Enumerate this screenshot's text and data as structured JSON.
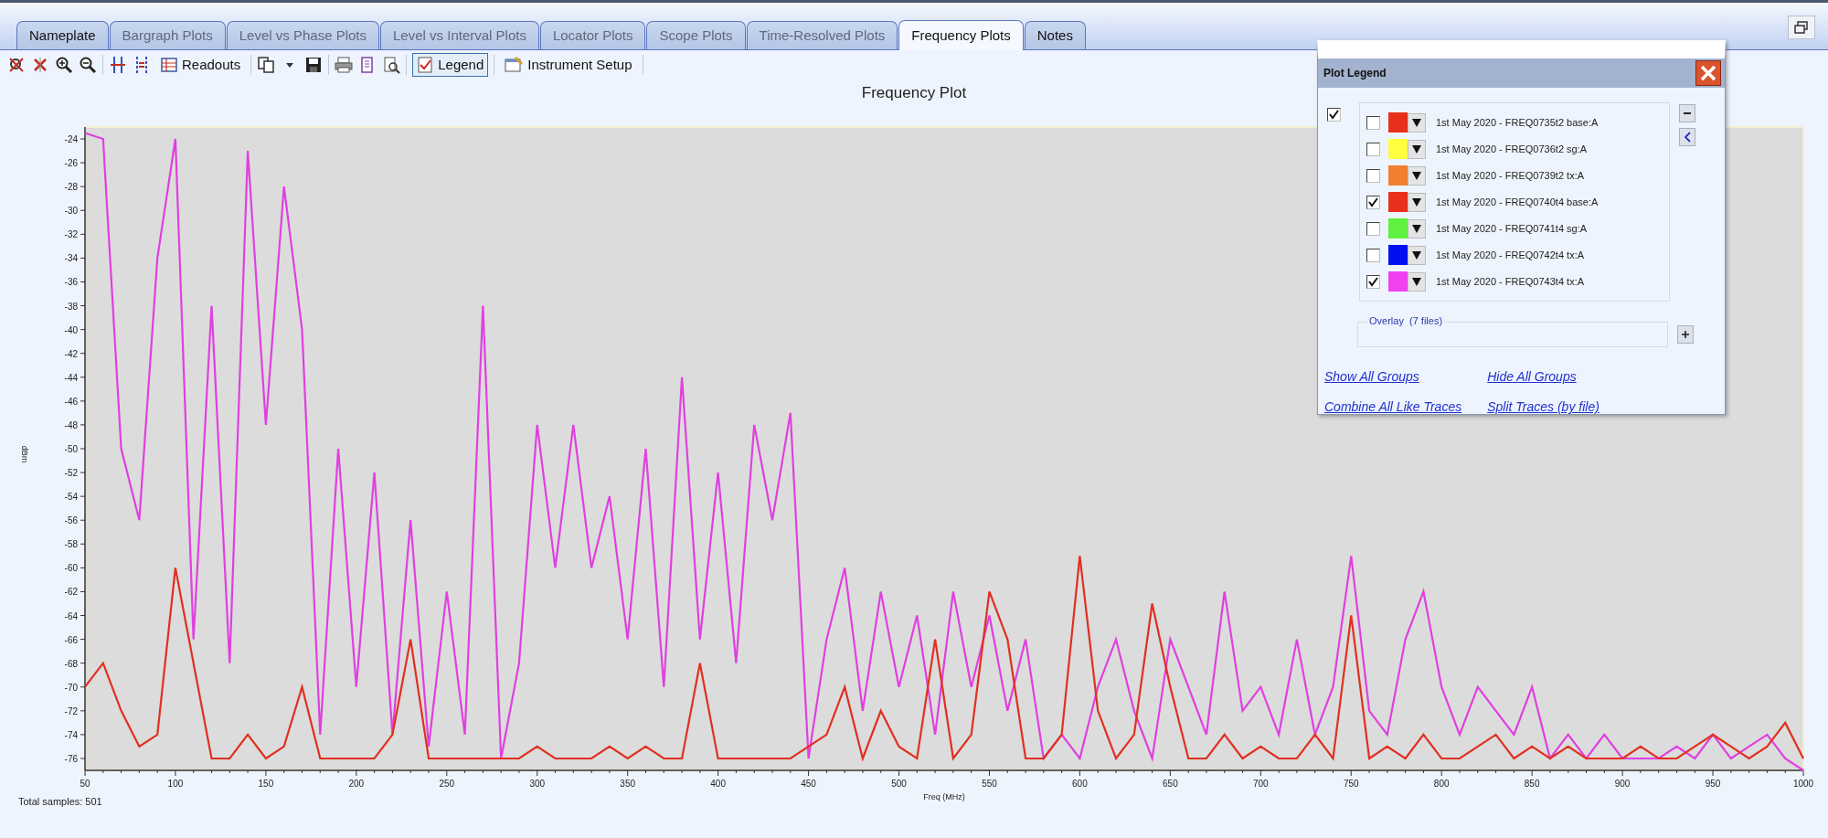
{
  "tabs": [
    {
      "label": "Nameplate",
      "selected": false,
      "disabled": false
    },
    {
      "label": "Bargraph Plots",
      "selected": false,
      "disabled": true
    },
    {
      "label": "Level vs Phase Plots",
      "selected": false,
      "disabled": true
    },
    {
      "label": "Level vs Interval Plots",
      "selected": false,
      "disabled": true
    },
    {
      "label": "Locator Plots",
      "selected": false,
      "disabled": true
    },
    {
      "label": "Scope Plots",
      "selected": false,
      "disabled": true
    },
    {
      "label": "Time-Resolved Plots",
      "selected": false,
      "disabled": true
    },
    {
      "label": "Frequency Plots",
      "selected": true,
      "disabled": false
    },
    {
      "label": "Notes",
      "selected": false,
      "disabled": false
    }
  ],
  "toolbar": {
    "readouts": {
      "label": "Readouts"
    },
    "legend": {
      "label": "Legend",
      "pressed": true
    },
    "instrument_setup": {
      "label": "Instrument Setup"
    }
  },
  "plot": {
    "total_samples": "Total samples: 501",
    "chart_data": {
      "type": "line",
      "title": "Frequency Plot",
      "xlabel": "Freq (MHz)",
      "ylabel": "dBm",
      "x": [
        50,
        60,
        70,
        80,
        90,
        100,
        110,
        120,
        130,
        140,
        150,
        160,
        170,
        180,
        190,
        200,
        210,
        220,
        230,
        240,
        250,
        260,
        270,
        280,
        290,
        300,
        310,
        320,
        330,
        340,
        350,
        360,
        370,
        380,
        390,
        400,
        410,
        420,
        430,
        440,
        450,
        460,
        470,
        480,
        490,
        500,
        510,
        520,
        530,
        540,
        550,
        560,
        570,
        580,
        590,
        600,
        610,
        620,
        630,
        640,
        650,
        660,
        670,
        680,
        690,
        700,
        710,
        720,
        730,
        740,
        750,
        760,
        770,
        780,
        790,
        800,
        810,
        820,
        830,
        840,
        850,
        860,
        870,
        880,
        890,
        900,
        910,
        920,
        930,
        940,
        950,
        960,
        970,
        980,
        990,
        1000
      ],
      "series": [
        {
          "color": "#e040e0",
          "values": [
            -23.5,
            -24,
            -50,
            -56,
            -34,
            -24,
            -66,
            -38,
            -68,
            -25,
            -48,
            -28,
            -40,
            -74,
            -50,
            -70,
            -52,
            -74,
            -56,
            -75,
            -62,
            -74,
            -38,
            -76,
            -68,
            -48,
            -60,
            -48,
            -60,
            -54,
            -66,
            -50,
            -70,
            -44,
            -66,
            -52,
            -68,
            -48,
            -56,
            -47,
            -76,
            -66,
            -60,
            -72,
            -62,
            -70,
            -64,
            -74,
            -62,
            -70,
            -64,
            -72,
            -66,
            -76,
            -74,
            -76,
            -70,
            -66,
            -72,
            -76,
            -66,
            -70,
            -74,
            -62,
            -72,
            -70,
            -74,
            -66,
            -74,
            -70,
            -59,
            -72,
            -74,
            -66,
            -62,
            -70,
            -74,
            -70,
            -72,
            -74,
            -70,
            -76,
            -74,
            -76,
            -74,
            -76,
            -76,
            -76,
            -75,
            -76,
            -74,
            -76,
            -75,
            -74,
            -76,
            -77
          ]
        },
        {
          "color": "#e03020",
          "values": [
            -70,
            -68,
            -72,
            -75,
            -74,
            -60,
            -68,
            -76,
            -76,
            -74,
            -76,
            -75,
            -70,
            -76,
            -76,
            -76,
            -76,
            -74,
            -66,
            -76,
            -76,
            -76,
            -76,
            -76,
            -76,
            -75,
            -76,
            -76,
            -76,
            -75,
            -76,
            -75,
            -76,
            -76,
            -68,
            -76,
            -76,
            -76,
            -76,
            -76,
            -75,
            -74,
            -70,
            -76,
            -72,
            -75,
            -76,
            -66,
            -76,
            -74,
            -62,
            -66,
            -76,
            -76,
            -74,
            -59,
            -72,
            -76,
            -74,
            -63,
            -70,
            -76,
            -76,
            -74,
            -76,
            -75,
            -76,
            -76,
            -74,
            -76,
            -64,
            -76,
            -75,
            -76,
            -74,
            -76,
            -76,
            -75,
            -74,
            -76,
            -75,
            -76,
            -75,
            -76,
            -76,
            -76,
            -75,
            -76,
            -76,
            -75,
            -74,
            -75,
            -76,
            -75,
            -73,
            -76
          ]
        }
      ],
      "xlim": [
        50,
        1000
      ],
      "ylim": [
        -77,
        -23
      ],
      "xticks": [
        50,
        100,
        150,
        200,
        250,
        300,
        350,
        400,
        450,
        500,
        550,
        600,
        650,
        700,
        750,
        800,
        850,
        900,
        950,
        1000
      ],
      "yticks": [
        -24,
        -26,
        -28,
        -30,
        -32,
        -34,
        -36,
        -38,
        -40,
        -42,
        -44,
        -46,
        -48,
        -50,
        -52,
        -54,
        -56,
        -58,
        -60,
        -62,
        -64,
        -66,
        -68,
        -70,
        -72,
        -74,
        -76
      ]
    }
  },
  "legend": {
    "title": "Plot Legend",
    "all_checked": true,
    "items": [
      {
        "label": "1st May 2020 - FREQ0735t2 base:A",
        "checked": false,
        "color": "#e8301c"
      },
      {
        "label": "1st May 2020 - FREQ0736t2 sg:A",
        "checked": false,
        "color": "#ffff40"
      },
      {
        "label": "1st May 2020 - FREQ0739t2 tx:A",
        "checked": false,
        "color": "#f08030"
      },
      {
        "label": "1st May 2020 - FREQ0740t4 base:A",
        "checked": true,
        "color": "#e8301c"
      },
      {
        "label": "1st May 2020 - FREQ0741t4 sg:A",
        "checked": false,
        "color": "#60f040"
      },
      {
        "label": "1st May 2020 - FREQ0742t4 tx:A",
        "checked": false,
        "color": "#0010f0"
      },
      {
        "label": "1st May 2020 - FREQ0743t4 tx:A",
        "checked": true,
        "color": "#f040f0"
      }
    ],
    "overlay": "Overlay  (7 files)",
    "links": [
      "Show All Groups",
      "Hide All Groups",
      "Combine All Like Traces",
      "Split Traces (by file)"
    ]
  }
}
